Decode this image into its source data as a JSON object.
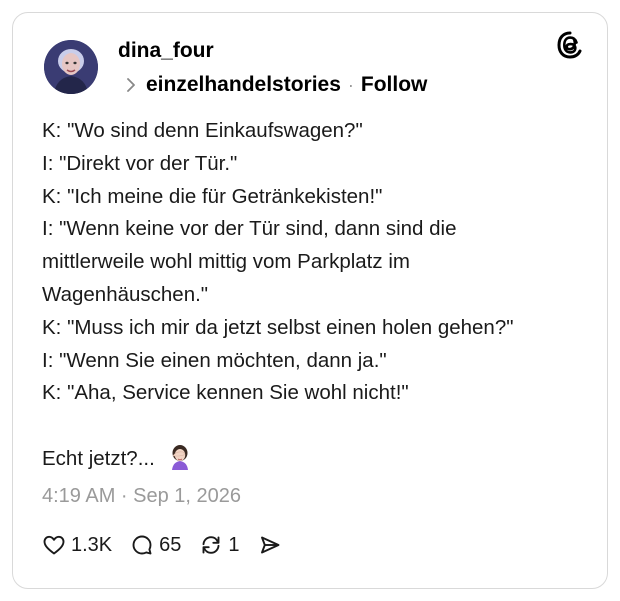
{
  "post": {
    "author": "dina_four",
    "community": "einzelhandelstories",
    "separator": "·",
    "follow_label": "Follow",
    "app_logo_icon": "threads-icon",
    "lines": [
      "K: \"Wo sind denn Einkaufswagen?\"",
      "I: \"Direkt vor der Tür.\"",
      "K: \"Ich meine die für Getränkekisten!\"",
      "I: \"Wenn keine vor der Tür sind, dann sind die",
      "mittlerweile wohl mittig vom Parkplatz im",
      "Wagenhäuschen.\"",
      "K: \"Muss ich mir da jetzt selbst einen holen gehen?\"",
      "I: \"Wenn Sie einen möchten, dann ja.\"",
      "K: \"Aha, Service kennen Sie wohl nicht!\""
    ],
    "closing": "Echt jetzt?...",
    "closing_emoji": "woman-facepalming-emoji",
    "timestamp": "4:19 AM · Sep 1, 2026",
    "stats": {
      "likes": "1.3K",
      "replies": "65",
      "reposts": "1"
    }
  }
}
